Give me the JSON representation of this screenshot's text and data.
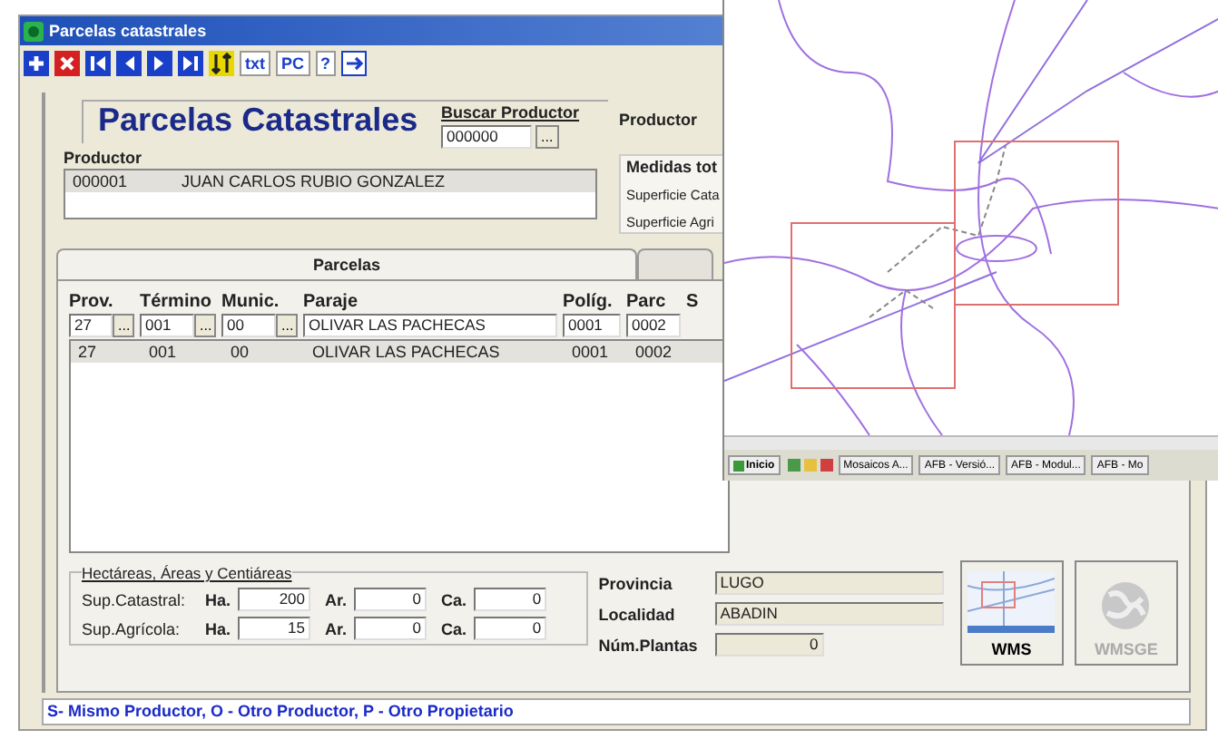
{
  "window": {
    "title": "Parcelas catastrales"
  },
  "toolbar": [
    {
      "kind": "add"
    },
    {
      "kind": "delete"
    },
    {
      "kind": "first"
    },
    {
      "kind": "prev"
    },
    {
      "kind": "next"
    },
    {
      "kind": "last"
    },
    {
      "kind": "swap"
    },
    {
      "kind": "text",
      "label": "txt"
    },
    {
      "kind": "text",
      "label": "PC"
    },
    {
      "kind": "text",
      "label": "?"
    },
    {
      "kind": "exit"
    }
  ],
  "header": {
    "title": "Parcelas Catastrales",
    "search_label": "Buscar Productor",
    "search_value": "000000",
    "search_button": "...",
    "productor_label": "Productor"
  },
  "productor": {
    "label": "Productor",
    "rows": [
      {
        "code": "000001",
        "name": "JUAN CARLOS RUBIO GONZALEZ",
        "selected": true
      }
    ]
  },
  "medidas": {
    "title": "Medidas tot",
    "lines": [
      "Superficie Cata",
      "Superficie Agri"
    ]
  },
  "tabs": [
    {
      "label": "Parcelas",
      "selected": true
    },
    {
      "selected": false
    }
  ],
  "parcelas": {
    "columns": [
      "Prov.",
      "Término",
      "Munic.",
      "Paraje",
      "Políg.",
      "Parc",
      "S"
    ],
    "edit": [
      {
        "value": "27",
        "button": "..."
      },
      {
        "value": "001",
        "button": "..."
      },
      {
        "value": "00",
        "button": "..."
      },
      {
        "value": "OLIVAR LAS PACHECAS"
      },
      {
        "value": "0001"
      },
      {
        "value": "0002"
      }
    ],
    "rows": [
      {
        "cells": [
          "27",
          "001",
          "00",
          "OLIVAR LAS PACHECAS",
          "0001",
          "0002"
        ],
        "selected": true
      }
    ]
  },
  "superficies": {
    "title": "Hectáreas, Áreas y Centiáreas",
    "rows": [
      {
        "label": "Sup.Catastral:",
        "fields": [
          {
            "unit": "Ha.",
            "value": "200"
          },
          {
            "unit": "Ar.",
            "value": "0"
          },
          {
            "unit": "Ca.",
            "value": "0"
          }
        ]
      },
      {
        "label": "Sup.Agrícola:",
        "fields": [
          {
            "unit": "Ha.",
            "value": "15"
          },
          {
            "unit": "Ar.",
            "value": "0"
          },
          {
            "unit": "Ca.",
            "value": "0"
          }
        ]
      }
    ]
  },
  "location": [
    {
      "label": "Provincia",
      "value": "LUGO"
    },
    {
      "label": "Localidad",
      "value": "ABADIN"
    },
    {
      "label": "Núm.Plantas",
      "value": "0"
    }
  ],
  "buttons": [
    {
      "label": "WMS",
      "disabled": false,
      "kind": "map"
    },
    {
      "label": "WMSGE",
      "disabled": true,
      "kind": "globe"
    }
  ],
  "status": "S- Mismo Productor, O - Otro Productor, P - Otro Propietario",
  "taskbar": [
    {
      "label": "Inicio",
      "kind": "start"
    },
    {
      "kind": "quick"
    },
    {
      "label": "Mosaicos A...",
      "kind": "task"
    },
    {
      "label": "AFB - Versió...",
      "kind": "task"
    },
    {
      "label": "AFB - Modul...",
      "kind": "task"
    },
    {
      "label": "AFB - Mo",
      "kind": "task"
    }
  ]
}
